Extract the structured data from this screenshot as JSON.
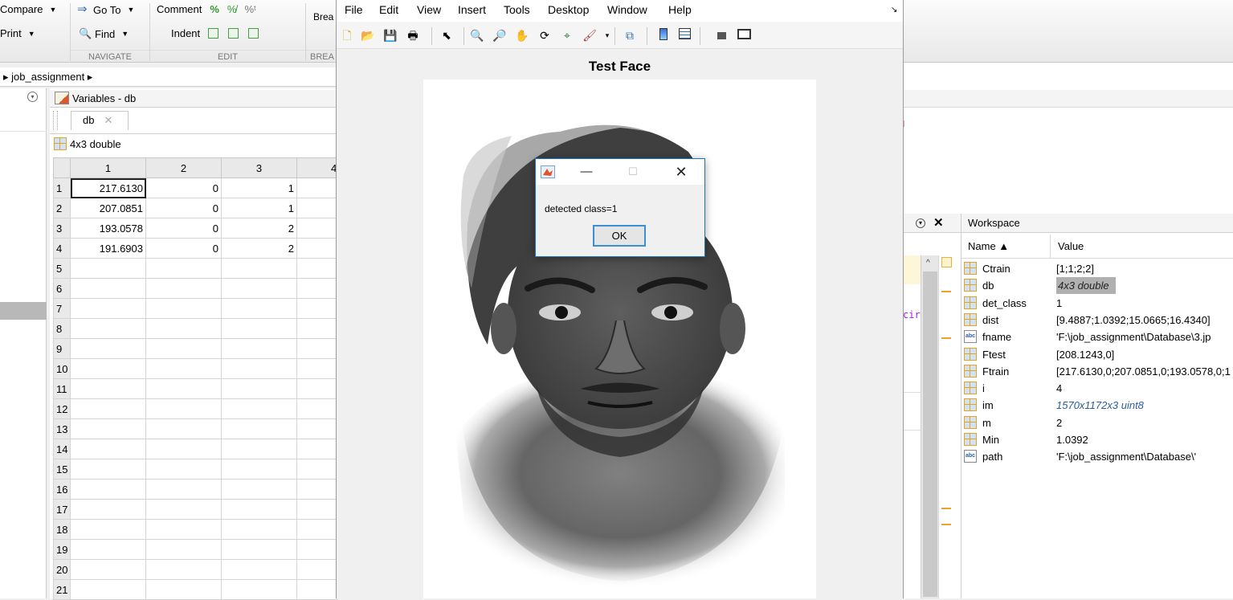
{
  "toolstrip": {
    "compare_label": "Compare",
    "print_label": "Print",
    "goto_label": "Go To",
    "find_label": "Find",
    "comment_label": "Comment",
    "indent_label": "Indent",
    "breakpoints_label": "Brea",
    "sections": {
      "navigate": "NAVIGATE",
      "edit": "EDIT",
      "breakpoints": "BREA"
    }
  },
  "address": {
    "path": "▸ job_assignment ▸"
  },
  "variables": {
    "panel_title": "Variables - db",
    "tab_label": "db",
    "size_label": "4x3 double",
    "col_headers": [
      "1",
      "2",
      "3",
      "4"
    ],
    "row_labels": [
      "1",
      "2",
      "3",
      "4",
      "5",
      "6",
      "7",
      "8",
      "9",
      "10",
      "11",
      "12",
      "13",
      "14",
      "15",
      "16",
      "17",
      "18",
      "19",
      "20",
      "21"
    ],
    "rows": [
      [
        "217.6130",
        "0",
        "1"
      ],
      [
        "207.0851",
        "0",
        "1"
      ],
      [
        "193.0578",
        "0",
        "2"
      ],
      [
        "191.6903",
        "0",
        "2"
      ]
    ]
  },
  "figure": {
    "menu": [
      "File",
      "Edit",
      "View",
      "Insert",
      "Tools",
      "Desktop",
      "Window",
      "Help"
    ],
    "menu_arrow": "↘",
    "axes_title": "Test Face"
  },
  "dialog": {
    "message": "detected class=1",
    "ok_label": "OK"
  },
  "editor": {
    "fragment": "cir"
  },
  "workspace": {
    "title": "Workspace",
    "name_header": "Name ▲",
    "value_header": "Value",
    "items": [
      {
        "name": "Ctrain",
        "value": "[1;1;2;2]",
        "icon": "grid-icon"
      },
      {
        "name": "db",
        "value": "4x3 double",
        "icon": "grid-icon"
      },
      {
        "name": "det_class",
        "value": "1",
        "icon": "grid-icon"
      },
      {
        "name": "dist",
        "value": "[9.4887;1.0392;15.0665;16.4340]",
        "icon": "grid-icon"
      },
      {
        "name": "fname",
        "value": "'F:\\job_assignment\\Database\\3.jp",
        "icon": "abc-icon"
      },
      {
        "name": "Ftest",
        "value": "[208.1243,0]",
        "icon": "grid-icon"
      },
      {
        "name": "Ftrain",
        "value": "[217.6130,0;207.0851,0;193.0578,0;1",
        "icon": "grid-icon"
      },
      {
        "name": "i",
        "value": "4",
        "icon": "grid-icon"
      },
      {
        "name": "im",
        "value": "1570x1172x3 uint8",
        "icon": "grid-icon"
      },
      {
        "name": "m",
        "value": "2",
        "icon": "grid-icon"
      },
      {
        "name": "Min",
        "value": "1.0392",
        "icon": "grid-icon"
      },
      {
        "name": "path",
        "value": "'F:\\job_assignment\\Database\\'",
        "icon": "abc-icon"
      }
    ]
  },
  "colors": {
    "accent_orange": "#e7a320",
    "dialog_border": "#1b73c4",
    "italic_value": "#2c5d9b"
  }
}
